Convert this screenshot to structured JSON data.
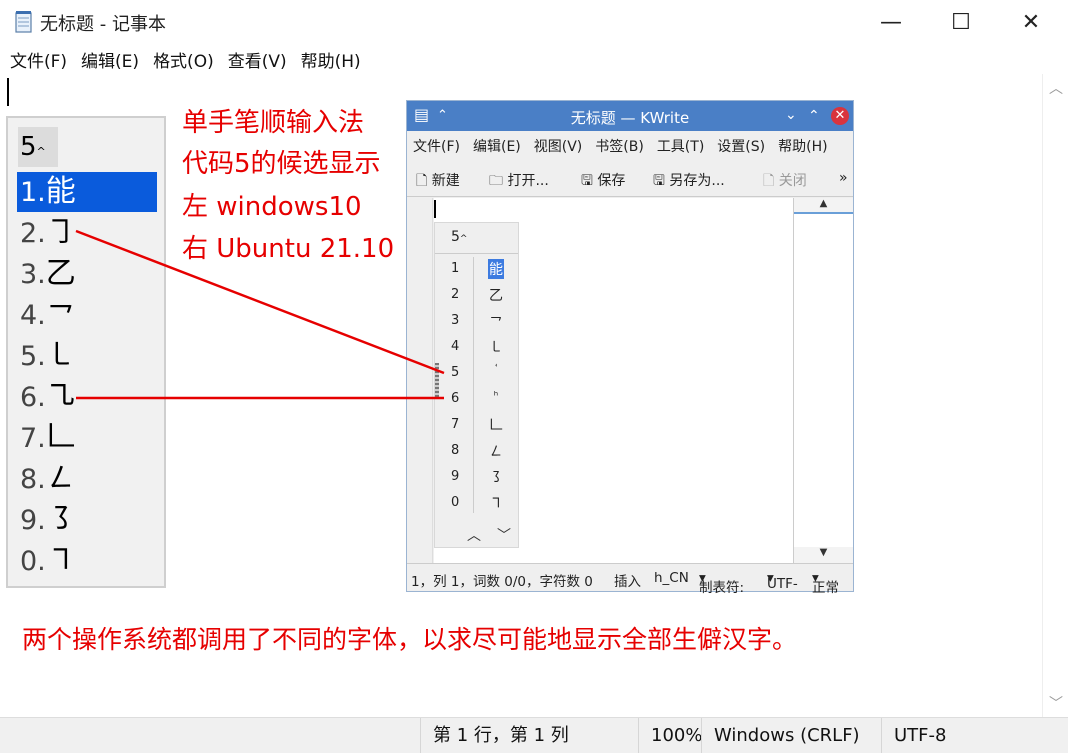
{
  "notepad": {
    "title": "无标题 - 记事本",
    "window_buttons": {
      "minimize": "—",
      "maximize": "☐",
      "close": "✕"
    },
    "menu": [
      "文件(F)",
      "编辑(E)",
      "格式(O)",
      "查看(V)",
      "帮助(H)"
    ],
    "status": {
      "position": "第 1 行，第 1 列",
      "zoom": "100%",
      "line_ending": "Windows (CRLF)",
      "encoding": "UTF-8"
    },
    "scroll_arrows": {
      "up": "︿",
      "down": "﹀"
    }
  },
  "ime_windows": {
    "code": "5",
    "code_mark": "^",
    "candidates": [
      {
        "num": "1.",
        "char": "能"
      },
      {
        "num": "2.",
        "char": "㇆"
      },
      {
        "num": "3.",
        "char": "乙"
      },
      {
        "num": "4.",
        "char": "㇖"
      },
      {
        "num": "5.",
        "char": "㇄"
      },
      {
        "num": "6.",
        "char": "㇈"
      },
      {
        "num": "7.",
        "char": "𠃊"
      },
      {
        "num": "8.",
        "char": "㇜"
      },
      {
        "num": "9.",
        "char": "㇌"
      },
      {
        "num": "0.",
        "char": "㇕"
      }
    ],
    "selected_index": 0,
    "selected_color": "#0a5bdc"
  },
  "annotation": {
    "lines": [
      "单手笔顺输入法",
      "代码5的候选显示",
      "左 windows10",
      "右 Ubuntu 21.10"
    ],
    "footer": "两个操作系统都调用了不同的字体，以求尽可能地显示全部生僻汉字。",
    "color": "#e60000"
  },
  "kwrite": {
    "title": "无标题 — KWrite",
    "menu": [
      "文件(F)",
      "编辑(E)",
      "视图(V)",
      "书签(B)",
      "工具(T)",
      "设置(S)",
      "帮助(H)"
    ],
    "toolbar": {
      "new": "新建",
      "open": "打开...",
      "save": "保存",
      "save_as": "另存为...",
      "close": "关闭",
      "more": "»"
    },
    "status": {
      "cursor": "1，列 1，词数 0/0，字符数 0",
      "mode": "插入",
      "lang": "h_CN",
      "tabs": "制表符:",
      "encoding": "UTF-",
      "view": "正常"
    },
    "title_color": "#4a7fc6"
  },
  "ime_ubuntu": {
    "code": "5",
    "code_mark": "^",
    "candidates": [
      {
        "num": "1",
        "char": "能"
      },
      {
        "num": "2",
        "char": "乙"
      },
      {
        "num": "3",
        "char": "㇖"
      },
      {
        "num": "4",
        "char": "㇄"
      },
      {
        "num": "5",
        "char": "ꜗ"
      },
      {
        "num": "6",
        "char": "ʰ"
      },
      {
        "num": "7",
        "char": "𠃊"
      },
      {
        "num": "8",
        "char": "㇜"
      },
      {
        "num": "9",
        "char": "㇌"
      },
      {
        "num": "0",
        "char": "㇕"
      }
    ],
    "selected_index": 0,
    "nav": {
      "prev": "︿",
      "next": "﹀"
    }
  }
}
